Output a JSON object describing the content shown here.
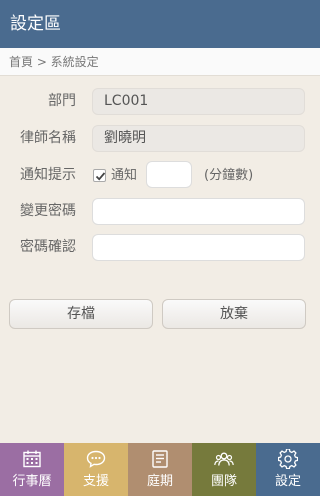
{
  "header": {
    "title": "設定區"
  },
  "breadcrumb": {
    "text": "首頁 > 系統設定"
  },
  "form": {
    "department": {
      "label": "部門",
      "value": "LC001"
    },
    "lawyer_name": {
      "label": "律師名稱",
      "value": "劉曉明"
    },
    "notify": {
      "label": "通知提示",
      "checkbox_label": "通知",
      "checked": true,
      "minutes_value": "",
      "unit": "(分鐘數)"
    },
    "change_password": {
      "label": "變更密碼",
      "value": ""
    },
    "confirm_password": {
      "label": "密碼確認",
      "value": ""
    }
  },
  "buttons": {
    "save": "存檔",
    "cancel": "放棄"
  },
  "tabs": [
    {
      "label": "行事曆",
      "icon": "calendar-icon",
      "color": "#9b6ea3"
    },
    {
      "label": "支援",
      "icon": "chat-bubble-icon",
      "color": "#d7b56d"
    },
    {
      "label": "庭期",
      "icon": "document-icon",
      "color": "#b08e70"
    },
    {
      "label": "團隊",
      "icon": "team-icon",
      "color": "#767a3c"
    },
    {
      "label": "設定",
      "icon": "gear-icon",
      "color": "#4a6b8f"
    }
  ],
  "colors": {
    "header": "#4a6b8f",
    "background": "#f2ede5"
  }
}
